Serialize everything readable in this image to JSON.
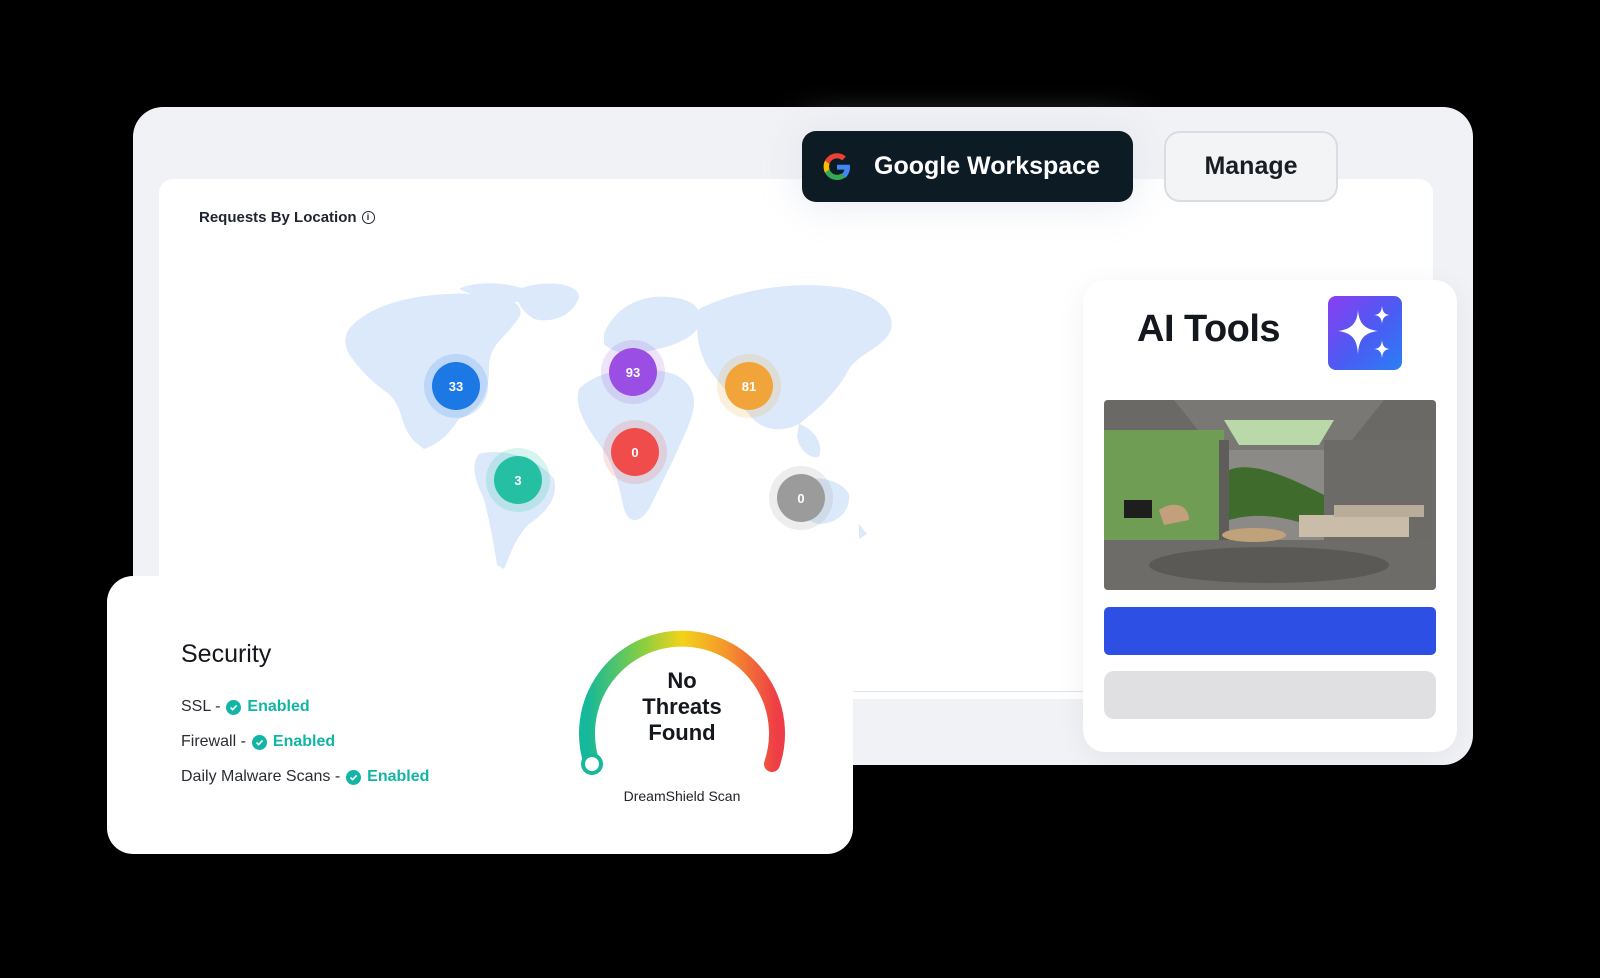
{
  "map": {
    "title": "Requests By Location",
    "markers": [
      {
        "label": "33",
        "color": "#1b78e4"
      },
      {
        "label": "93",
        "color": "#9a4ee3"
      },
      {
        "label": "81",
        "color": "#f1a43a"
      },
      {
        "label": "0",
        "color": "#f04c4c"
      },
      {
        "label": "3",
        "color": "#25c0a4"
      },
      {
        "label": "0",
        "color": "#9b9b9b"
      }
    ]
  },
  "workspace": {
    "label": "Google Workspace",
    "manage_label": "Manage"
  },
  "ai_tools": {
    "title": "AI Tools"
  },
  "security": {
    "title": "Security",
    "items": [
      {
        "label": "SSL -",
        "status": "Enabled"
      },
      {
        "label": "Firewall -",
        "status": "Enabled"
      },
      {
        "label": "Daily Malware Scans -",
        "status": "Enabled"
      }
    ],
    "gauge_text": [
      "No",
      "Threats",
      "Found"
    ],
    "gauge_label": "DreamShield Scan"
  },
  "colors": {
    "accent_green": "#12b5a5",
    "dark_button": "#0d1b24",
    "ai_blue": "#2e4fe3"
  }
}
